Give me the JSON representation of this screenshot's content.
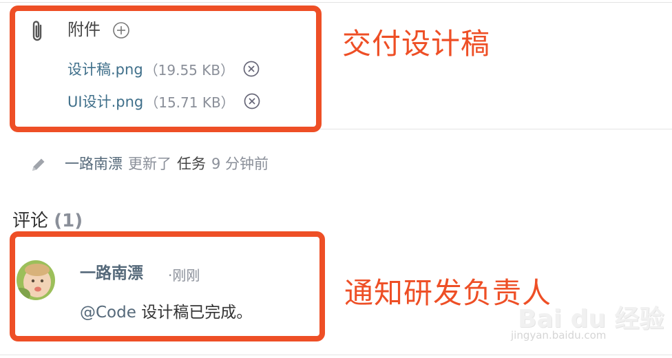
{
  "attachments": {
    "title": "附件",
    "files": [
      {
        "name": "设计稿.png",
        "size": "（19.55 KB）"
      },
      {
        "name": "UI设计.png",
        "size": "（15.71 KB）"
      }
    ]
  },
  "activity": {
    "user": "一路南漂",
    "verb": "更新了",
    "object": "任务",
    "time": "9 分钟前"
  },
  "comments": {
    "title": "评论",
    "count": "(1)",
    "items": [
      {
        "author": "一路南漂",
        "time": "·刚刚",
        "mention": "@Code",
        "text": " 设计稿已完成。"
      }
    ]
  },
  "annotations": {
    "label_1": "交付设计稿",
    "label_2": "通知研发负责人",
    "color": "#ee4f26"
  },
  "watermark": {
    "brand": "Bai du 经验",
    "url": "jingyan.baidu.com"
  }
}
